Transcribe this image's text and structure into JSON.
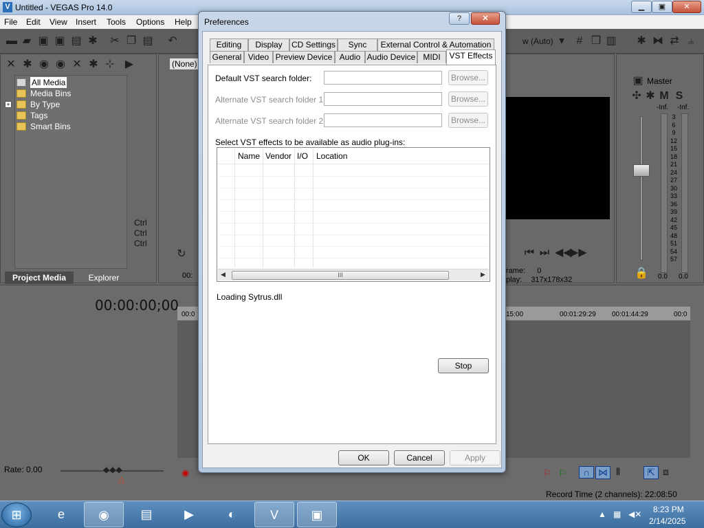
{
  "app": {
    "title": "Untitled - VEGAS Pro 14.0",
    "icon_letter": "V",
    "window_controls": {
      "minimize": "▁",
      "restore": "▣",
      "close": "✕"
    }
  },
  "menu": [
    "File",
    "Edit",
    "View",
    "Insert",
    "Tools",
    "Options",
    "Help"
  ],
  "toolbar": {
    "preset": "(None)",
    "preview_quality": "w (Auto)"
  },
  "project_media": {
    "tree": [
      "All Media",
      "Media Bins",
      "By Type",
      "Tags",
      "Smart Bins"
    ],
    "expand_symbol": "+",
    "tabs": [
      "Project Media",
      "Explorer"
    ]
  },
  "middle_panel": {
    "ctrl_lines": [
      "Ctrl",
      "Ctrl",
      "Ctrl"
    ],
    "counter": "00:"
  },
  "master_bus": {
    "label": "Master",
    "mute": "M",
    "solo": "S",
    "peak_left": "-Inf.",
    "peak_right": "-Inf.",
    "scale": [
      "3",
      "6",
      "9",
      "12",
      "15",
      "18",
      "21",
      "24",
      "27",
      "30",
      "33",
      "36",
      "39",
      "42",
      "45",
      "48",
      "51",
      "54",
      "57"
    ],
    "value_left": "0.0",
    "value_right": "0.0"
  },
  "preview_info": {
    "frame_label": "rame:",
    "frame_value": "0",
    "display_label": "play:",
    "display_value": "317x178x32"
  },
  "timeline": {
    "time": "00:00:00;00",
    "ruler": [
      "00:0",
      "15:00",
      "00:01:29:29",
      "00:01:44:29",
      "00:0"
    ],
    "rate": "Rate: 0.00",
    "record_time": "Record Time (2 channels): 22:08:50"
  },
  "dialog": {
    "title": "Preferences",
    "help": "?",
    "close": "✕",
    "tabs_row1": [
      "Editing",
      "Display",
      "CD Settings",
      "Sync",
      "External Control & Automation"
    ],
    "tabs_row2": [
      "General",
      "Video",
      "Preview Device",
      "Audio",
      "Audio Device",
      "MIDI",
      "VST Effects"
    ],
    "default_folder_label": "Default VST search folder:",
    "alt_folder1_label": "Alternate VST search folder 1:",
    "alt_folder2_label": "Alternate VST search folder 2:",
    "browse": "Browse...",
    "select_label": "Select VST effects to be available as audio plug-ins:",
    "columns": [
      "Name",
      "Vendor",
      "I/O",
      "Location"
    ],
    "scroll_thumb": "III",
    "loading": "Loading Sytrus.dll",
    "stop": "Stop",
    "ok": "OK",
    "cancel": "Cancel",
    "apply": "Apply"
  },
  "taskbar": {
    "time": "8:23 PM",
    "date": "2/14/2025",
    "start_icon": "windows-orb-icon",
    "apps": [
      "internet-explorer-icon",
      "firefox-icon",
      "file-explorer-icon",
      "media-player-icon",
      "media-app-icon",
      "vegas-icon",
      "notepad-icon"
    ]
  }
}
